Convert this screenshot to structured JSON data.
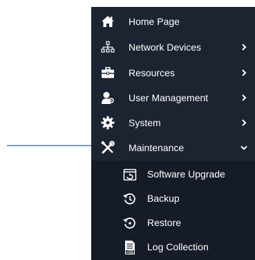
{
  "menu": {
    "items": [
      {
        "label": "Home Page",
        "icon": "home-icon",
        "has_children": false
      },
      {
        "label": "Network Devices",
        "icon": "network-icon",
        "has_children": true
      },
      {
        "label": "Resources",
        "icon": "briefcase-icon",
        "has_children": true
      },
      {
        "label": "User Management",
        "icon": "user-icon",
        "has_children": true
      },
      {
        "label": "System",
        "icon": "gear-icon",
        "has_children": true
      },
      {
        "label": "Maintenance",
        "icon": "tools-icon",
        "has_children": true,
        "expanded": true
      }
    ],
    "maintenance_submenu": [
      {
        "label": "Software Upgrade",
        "icon": "upgrade-icon"
      },
      {
        "label": "Backup",
        "icon": "backup-icon"
      },
      {
        "label": "Restore",
        "icon": "restore-icon"
      },
      {
        "label": "Log Collection",
        "icon": "log-icon"
      }
    ]
  },
  "colors": {
    "sidebar_bg": "#1c2331",
    "submenu_bg": "#161c27",
    "text": "#ffffff",
    "annotation_arrow": "#4a7fc1"
  },
  "annotation": {
    "arrow_points_to": "Maintenance"
  }
}
